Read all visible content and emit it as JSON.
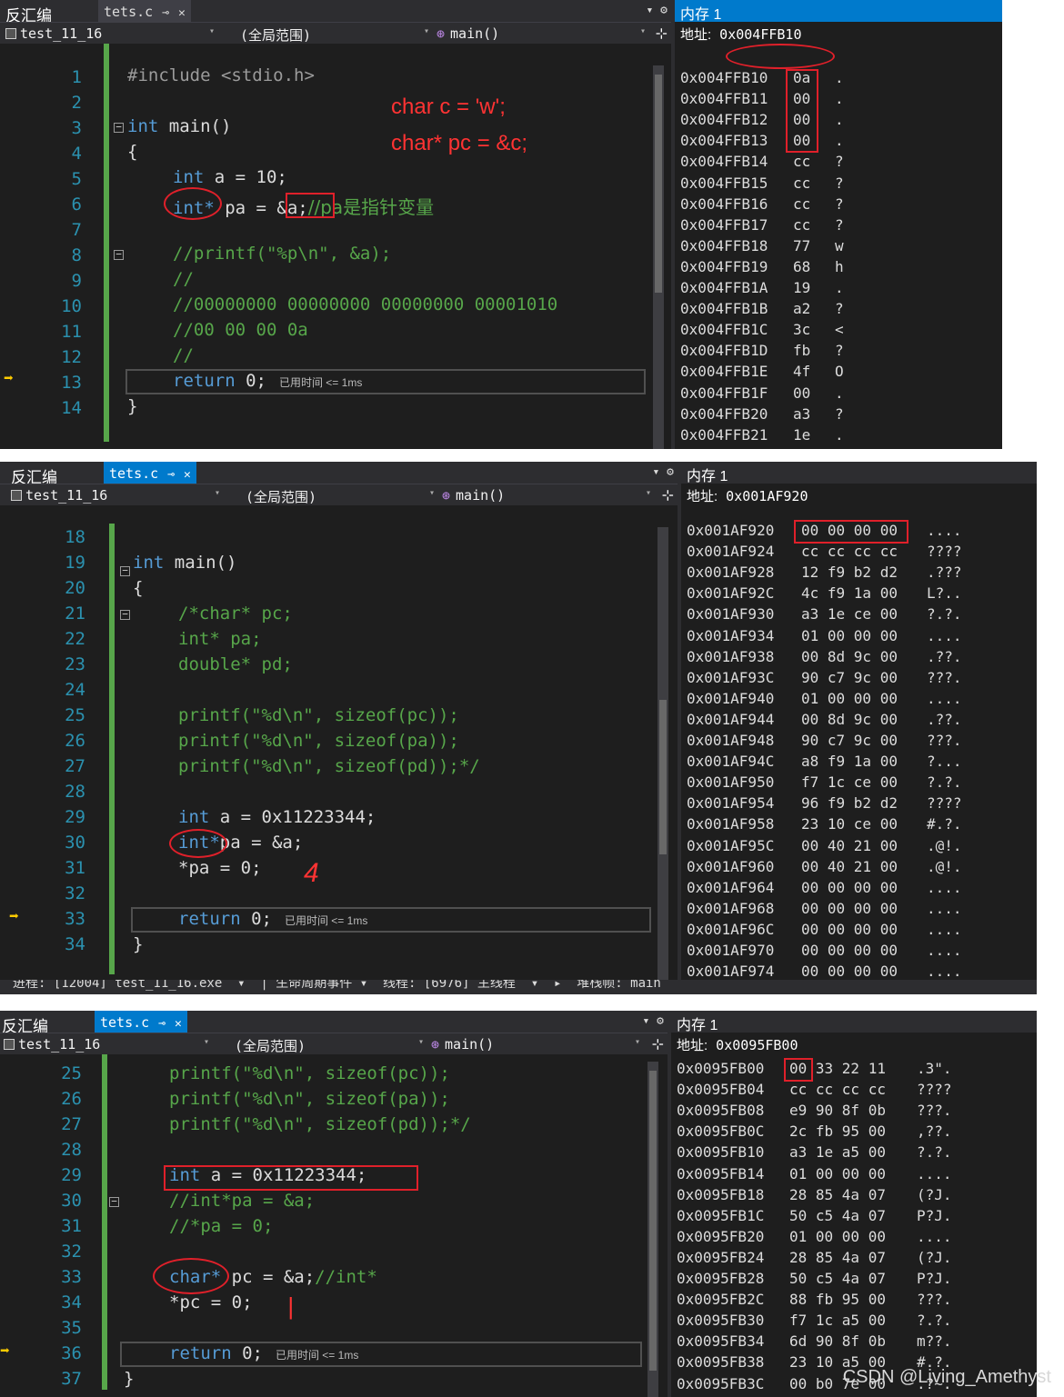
{
  "panels": [
    {
      "disasm_tab": "反汇编",
      "file_tab": "tets.c",
      "project": "test_11_16",
      "scope": "(全局范围)",
      "function": "main()",
      "memory_title": "内存 1",
      "address_label": "地址:",
      "address_value": "0x004FFB10",
      "line_numbers": [
        "1",
        "2",
        "3",
        "4",
        "5",
        "6",
        "7",
        "8",
        "9",
        "10",
        "11",
        "12",
        "13",
        "14"
      ],
      "code": {
        "l1": "#include <stdio.h>",
        "l3_kw": "int",
        "l3_rest": " main()",
        "l4": "{",
        "l5_kw": "int",
        "l5_rest": " a = 10;",
        "l6_kw": "int*",
        "l6_rest": " pa = &a;",
        "l6_comment": "//pa是指针变量",
        "l8": "//printf(\"%p\\n\", &a);",
        "l9": "//",
        "l10": "//00000000 00000000 00000000 00001010",
        "l11": "//00 00 00 0a",
        "l12": "//",
        "l13_kw": "return",
        "l13_rest": " 0;",
        "elapsed": "已用时间 <= 1ms",
        "l14": "}"
      },
      "annotations": [
        "char c = 'w';",
        "char* pc = &c;"
      ],
      "memory_rows": [
        {
          "addr": "0x004FFB10",
          "bytes": "0a",
          "ascii": "."
        },
        {
          "addr": "0x004FFB11",
          "bytes": "00",
          "ascii": "."
        },
        {
          "addr": "0x004FFB12",
          "bytes": "00",
          "ascii": "."
        },
        {
          "addr": "0x004FFB13",
          "bytes": "00",
          "ascii": "."
        },
        {
          "addr": "0x004FFB14",
          "bytes": "cc",
          "ascii": "?"
        },
        {
          "addr": "0x004FFB15",
          "bytes": "cc",
          "ascii": "?"
        },
        {
          "addr": "0x004FFB16",
          "bytes": "cc",
          "ascii": "?"
        },
        {
          "addr": "0x004FFB17",
          "bytes": "cc",
          "ascii": "?"
        },
        {
          "addr": "0x004FFB18",
          "bytes": "77",
          "ascii": "w"
        },
        {
          "addr": "0x004FFB19",
          "bytes": "68",
          "ascii": "h"
        },
        {
          "addr": "0x004FFB1A",
          "bytes": "19",
          "ascii": "."
        },
        {
          "addr": "0x004FFB1B",
          "bytes": "a2",
          "ascii": "?"
        },
        {
          "addr": "0x004FFB1C",
          "bytes": "3c",
          "ascii": "<"
        },
        {
          "addr": "0x004FFB1D",
          "bytes": "fb",
          "ascii": "?"
        },
        {
          "addr": "0x004FFB1E",
          "bytes": "4f",
          "ascii": "O"
        },
        {
          "addr": "0x004FFB1F",
          "bytes": "00",
          "ascii": "."
        },
        {
          "addr": "0x004FFB20",
          "bytes": "a3",
          "ascii": "?"
        },
        {
          "addr": "0x004FFB21",
          "bytes": "1e",
          "ascii": "."
        }
      ]
    },
    {
      "disasm_tab": "反汇编",
      "file_tab": "tets.c",
      "project": "test_11_16",
      "scope": "(全局范围)",
      "function": "main()",
      "memory_title": "内存 1",
      "address_label": "地址:",
      "address_value": "0x001AF920",
      "line_numbers": [
        "18",
        "19",
        "20",
        "21",
        "22",
        "23",
        "24",
        "25",
        "26",
        "27",
        "28",
        "29",
        "30",
        "31",
        "32",
        "33",
        "34"
      ],
      "code": {
        "l19_kw": "int",
        "l19_rest": " main()",
        "l20": "{",
        "l21": "/*char* pc;",
        "l22": "int* pa;",
        "l23": "double* pd;",
        "l25": "printf(\"%d\\n\", sizeof(pc));",
        "l26": "printf(\"%d\\n\", sizeof(pa));",
        "l27": "printf(\"%d\\n\", sizeof(pd));*/",
        "l29_kw": "int",
        "l29_rest": " a = 0x11223344;",
        "l30_kw": "int*",
        "l30_rest": "pa = &a;",
        "l31": "*pa = 0;",
        "l33_kw": "return",
        "l33_rest": " 0;",
        "elapsed": "已用时间 <= 1ms",
        "l34": "}"
      },
      "annotations": [
        "4"
      ],
      "memory_rows": [
        {
          "addr": "0x001AF920",
          "bytes": "00 00 00 00",
          "ascii": "...."
        },
        {
          "addr": "0x001AF924",
          "bytes": "cc cc cc cc",
          "ascii": "????"
        },
        {
          "addr": "0x001AF928",
          "bytes": "12 f9 b2 d2",
          "ascii": ".???"
        },
        {
          "addr": "0x001AF92C",
          "bytes": "4c f9 1a 00",
          "ascii": "L?.."
        },
        {
          "addr": "0x001AF930",
          "bytes": "a3 1e ce 00",
          "ascii": "?.?."
        },
        {
          "addr": "0x001AF934",
          "bytes": "01 00 00 00",
          "ascii": "...."
        },
        {
          "addr": "0x001AF938",
          "bytes": "00 8d 9c 00",
          "ascii": ".??."
        },
        {
          "addr": "0x001AF93C",
          "bytes": "90 c7 9c 00",
          "ascii": "???."
        },
        {
          "addr": "0x001AF940",
          "bytes": "01 00 00 00",
          "ascii": "...."
        },
        {
          "addr": "0x001AF944",
          "bytes": "00 8d 9c 00",
          "ascii": ".??."
        },
        {
          "addr": "0x001AF948",
          "bytes": "90 c7 9c 00",
          "ascii": "???."
        },
        {
          "addr": "0x001AF94C",
          "bytes": "a8 f9 1a 00",
          "ascii": "?..."
        },
        {
          "addr": "0x001AF950",
          "bytes": "f7 1c ce 00",
          "ascii": "?.?."
        },
        {
          "addr": "0x001AF954",
          "bytes": "96 f9 b2 d2",
          "ascii": "????"
        },
        {
          "addr": "0x001AF958",
          "bytes": "23 10 ce 00",
          "ascii": "#.?."
        },
        {
          "addr": "0x001AF95C",
          "bytes": "00 40 21 00",
          "ascii": ".@!."
        },
        {
          "addr": "0x001AF960",
          "bytes": "00 40 21 00",
          "ascii": ".@!."
        },
        {
          "addr": "0x001AF964",
          "bytes": "00 00 00 00",
          "ascii": "...."
        },
        {
          "addr": "0x001AF968",
          "bytes": "00 00 00 00",
          "ascii": "...."
        },
        {
          "addr": "0x001AF96C",
          "bytes": "00 00 00 00",
          "ascii": "...."
        },
        {
          "addr": "0x001AF970",
          "bytes": "00 00 00 00",
          "ascii": "...."
        },
        {
          "addr": "0x001AF974",
          "bytes": "00 00 00 00",
          "ascii": "...."
        }
      ]
    },
    {
      "disasm_tab": "反汇编",
      "file_tab": "tets.c",
      "project": "test_11_16",
      "scope": "(全局范围)",
      "function": "main()",
      "memory_title": "内存 1",
      "address_label": "地址:",
      "address_value": "0x0095FB00",
      "line_numbers": [
        "25",
        "26",
        "27",
        "28",
        "29",
        "30",
        "31",
        "32",
        "33",
        "34",
        "35",
        "36",
        "37"
      ],
      "code": {
        "l25": "printf(\"%d\\n\", sizeof(pc));",
        "l26": "printf(\"%d\\n\", sizeof(pa));",
        "l27": "printf(\"%d\\n\", sizeof(pd));*/",
        "l29_kw": "int",
        "l29_rest": " a = 0x11223344;",
        "l30": "//int*pa = &a;",
        "l31": "//*pa = 0;",
        "l33_kw": "char*",
        "l33_rest": " pc = &a;",
        "l33_comment": "//int*",
        "l34": "*pc = 0;",
        "l36_kw": "return",
        "l36_rest": " 0;",
        "elapsed": "已用时间 <= 1ms",
        "l37": "}"
      },
      "annotations": [
        "|"
      ],
      "memory_rows": [
        {
          "addr": "0x0095FB00",
          "bytes": "00 33 22 11",
          "ascii": ".3\"."
        },
        {
          "addr": "0x0095FB04",
          "bytes": "cc cc cc cc",
          "ascii": "????"
        },
        {
          "addr": "0x0095FB08",
          "bytes": "e9 90 8f 0b",
          "ascii": "???."
        },
        {
          "addr": "0x0095FB0C",
          "bytes": "2c fb 95 00",
          "ascii": ",??."
        },
        {
          "addr": "0x0095FB10",
          "bytes": "a3 1e a5 00",
          "ascii": "?.?."
        },
        {
          "addr": "0x0095FB14",
          "bytes": "01 00 00 00",
          "ascii": "...."
        },
        {
          "addr": "0x0095FB18",
          "bytes": "28 85 4a 07",
          "ascii": "(?J."
        },
        {
          "addr": "0x0095FB1C",
          "bytes": "50 c5 4a 07",
          "ascii": "P?J."
        },
        {
          "addr": "0x0095FB20",
          "bytes": "01 00 00 00",
          "ascii": "...."
        },
        {
          "addr": "0x0095FB24",
          "bytes": "28 85 4a 07",
          "ascii": "(?J."
        },
        {
          "addr": "0x0095FB28",
          "bytes": "50 c5 4a 07",
          "ascii": "P?J."
        },
        {
          "addr": "0x0095FB2C",
          "bytes": "88 fb 95 00",
          "ascii": "???."
        },
        {
          "addr": "0x0095FB30",
          "bytes": "f7 1c a5 00",
          "ascii": "?.?."
        },
        {
          "addr": "0x0095FB34",
          "bytes": "6d 90 8f 0b",
          "ascii": "m??."
        },
        {
          "addr": "0x0095FB38",
          "bytes": "23 10 a5 00",
          "ascii": "#.?."
        },
        {
          "addr": "0x0095FB3C",
          "bytes": "00 b0 7e 00",
          "ascii": ".?~."
        }
      ]
    }
  ],
  "process_bar": "进程: [12004] test_11_16.exe  ▾  | 生命周期事件 ▾  线程: [6976] 主线程  ▾  ▸  堆栈帧: main",
  "watermark": "CSDN @Living_Amethyst",
  "colors": {
    "editor_bg": "#1e1e1e",
    "keyword": "#569cd6",
    "comment": "#57a64a",
    "line_number": "#2b91af",
    "annotation_red": "#e0202a",
    "accent_blue": "#007acc"
  }
}
